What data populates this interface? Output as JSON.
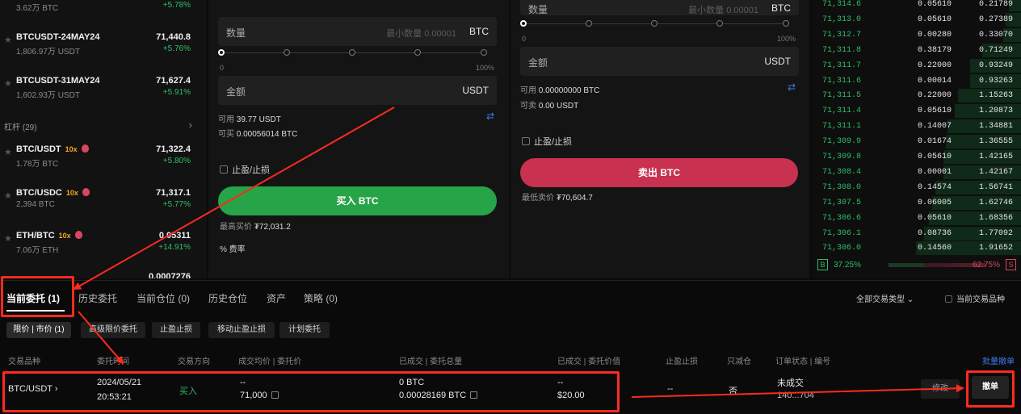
{
  "markets": {
    "top_row": {
      "volume": "3.62万 BTC",
      "change": "+5.78%"
    },
    "rows": [
      {
        "symbol": "BTCUSDT-24MAY24",
        "volume": "1,806.97万 USDT",
        "price": "71,440.8",
        "change": "+5.76%"
      },
      {
        "symbol": "BTCUSDT-31MAY24",
        "volume": "1,602.93万 USDT",
        "price": "71,627.4",
        "change": "+5.91%"
      }
    ],
    "leverage_header": "杠杆 (29)",
    "leverage_rows": [
      {
        "symbol": "BTC/USDT",
        "leverage": "10x",
        "volume": "1.78万 BTC",
        "price": "71,322.4",
        "change": "+5.80%"
      },
      {
        "symbol": "BTC/USDC",
        "leverage": "10x",
        "volume": "2,394 BTC",
        "price": "71,317.1",
        "change": "+5.77%"
      },
      {
        "symbol": "ETH/BTC",
        "leverage": "10x",
        "volume": "7.06万 ETH",
        "price": "0.05311",
        "change": "+14.91%"
      }
    ],
    "cut_price": "0.0007276"
  },
  "buy_panel": {
    "qty_label": "数量",
    "qty_placeholder": "最小数量 0.00001",
    "qty_unit": "BTC",
    "slider_min": "0",
    "slider_max": "100%",
    "amount_label": "金额",
    "amount_unit": "USDT",
    "available_label": "可用",
    "available_value": "39.77 USDT",
    "can_buy_label": "可买",
    "can_buy_value": "0.00056014 BTC",
    "tpsl_label": "止盈/止损",
    "button": "买入 BTC",
    "max_price_label": "最高买价",
    "max_price_value": "₮72,031.2",
    "fee_label": "% 费率"
  },
  "sell_panel": {
    "qty_label": "数量",
    "qty_placeholder": "最小数量 0.00001",
    "qty_unit": "BTC",
    "slider_min": "0",
    "slider_max": "100%",
    "amount_label": "金额",
    "amount_unit": "USDT",
    "available_label": "可用",
    "available_value": "0.00000000 BTC",
    "can_sell_label": "可卖",
    "can_sell_value": "0.00 USDT",
    "tpsl_label": "止盈/止损",
    "button": "卖出 BTC",
    "min_price_label": "最低卖价",
    "min_price_value": "₮70,604.7"
  },
  "order_book": [
    {
      "price": "71,314.6",
      "qty": "0.05610",
      "total": "0.21789"
    },
    {
      "price": "71,313.0",
      "qty": "0.05610",
      "total": "0.27389"
    },
    {
      "price": "71,312.7",
      "qty": "0.00280",
      "total": "0.33070"
    },
    {
      "price": "71,311.8",
      "qty": "0.38179",
      "total": "0.71249"
    },
    {
      "price": "71,311.7",
      "qty": "0.22000",
      "total": "0.93249"
    },
    {
      "price": "71,311.6",
      "qty": "0.00014",
      "total": "0.93263"
    },
    {
      "price": "71,311.5",
      "qty": "0.22000",
      "total": "1.15263"
    },
    {
      "price": "71,311.4",
      "qty": "0.05610",
      "total": "1.20873"
    },
    {
      "price": "71,311.1",
      "qty": "0.14007",
      "total": "1.34881"
    },
    {
      "price": "71,309.9",
      "qty": "0.01674",
      "total": "1.36555"
    },
    {
      "price": "71,309.8",
      "qty": "0.05610",
      "total": "1.42165"
    },
    {
      "price": "71,308.4",
      "qty": "0.00001",
      "total": "1.42167"
    },
    {
      "price": "71,308.0",
      "qty": "0.14574",
      "total": "1.56741"
    },
    {
      "price": "71,307.5",
      "qty": "0.06005",
      "total": "1.62746"
    },
    {
      "price": "71,306.6",
      "qty": "0.05610",
      "total": "1.68356"
    },
    {
      "price": "71,306.1",
      "qty": "0.08736",
      "total": "1.77092"
    },
    {
      "price": "71,306.0",
      "qty": "0.14560",
      "total": "1.91652"
    }
  ],
  "ratio": {
    "buy_label": "B",
    "buy_pct": "37.25%",
    "sell_pct": "62.75%",
    "sell_label": "S",
    "buy_fraction": 0.3725
  },
  "bottom": {
    "tabs": [
      "当前委托 (1)",
      "历史委托",
      "当前仓位 (0)",
      "历史仓位",
      "资产",
      "策略 (0)"
    ],
    "filter_type": "全部交易类型",
    "filter_current": "当前交易品种",
    "chips": [
      "限价 | 市价 (1)",
      "高级限价委托",
      "止盈止损",
      "移动止盈止损",
      "计划委托"
    ],
    "headers": [
      "交易品种",
      "委托时间",
      "交易方向",
      "成交均价 | 委托价",
      "已成交 | 委托总量",
      "已成交 | 委托价值",
      "止盈止损",
      "只减仓",
      "订单状态 | 编号"
    ],
    "bulk_cancel": "批量撤单",
    "order": {
      "symbol": "BTC/USDT",
      "date": "2024/05/21",
      "time": "20:53:21",
      "side": "买入",
      "avg_price": "--",
      "order_price": "71,000",
      "filled": "0 BTC",
      "total": "0.00028169 BTC",
      "filled_value": "--",
      "order_value": "$20.00",
      "tpsl": "--",
      "reduce_only": "否",
      "status": "未成交",
      "order_id": "140...704",
      "modify": "修改",
      "cancel": "撤单"
    }
  },
  "annotation_color": "#ff2a1f"
}
